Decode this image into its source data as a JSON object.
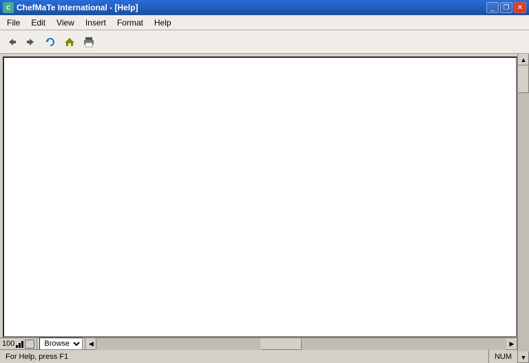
{
  "titleBar": {
    "appName": "ChefMaTe International",
    "windowTitle": "[Help]",
    "fullTitle": "ChefMaTe International - [Help]",
    "minimizeLabel": "_",
    "restoreLabel": "❐",
    "closeLabel": "✕"
  },
  "menuBar": {
    "items": [
      {
        "id": "file",
        "label": "File"
      },
      {
        "id": "edit",
        "label": "Edit"
      },
      {
        "id": "view",
        "label": "View"
      },
      {
        "id": "insert",
        "label": "Insert"
      },
      {
        "id": "format",
        "label": "Format"
      },
      {
        "id": "help",
        "label": "Help"
      }
    ]
  },
  "toolbar": {
    "buttons": [
      {
        "id": "back",
        "icon": "◁",
        "tooltip": "Back"
      },
      {
        "id": "forward",
        "icon": "▷",
        "tooltip": "Forward"
      },
      {
        "id": "refresh",
        "icon": "↻",
        "tooltip": "Refresh"
      },
      {
        "id": "home",
        "icon": "⌂",
        "tooltip": "Home"
      },
      {
        "id": "print",
        "icon": "🖨",
        "tooltip": "Print"
      }
    ]
  },
  "statusBar": {
    "zoomValue": "100",
    "browseOptions": [
      "Browse"
    ],
    "browseDefault": "Browse",
    "statusText": "For Help, press F1",
    "numIndicator": "NUM",
    "scrollLeftIcon": "◀",
    "scrollRightIcon": "▶",
    "scrollUpIcon": "▲",
    "scrollDownIcon": "▼"
  }
}
